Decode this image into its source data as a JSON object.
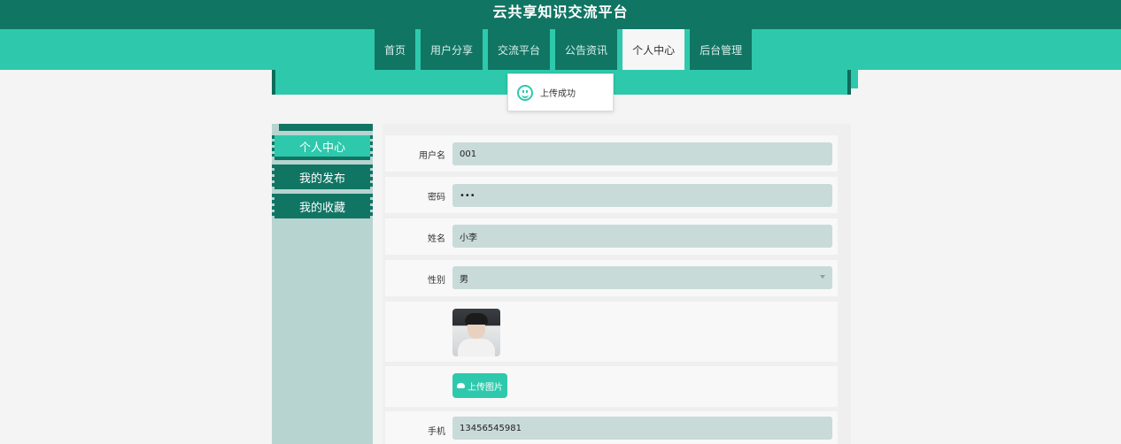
{
  "app": {
    "title": "云共享知识交流平台"
  },
  "nav": {
    "items": [
      {
        "label": "首页"
      },
      {
        "label": "用户分享"
      },
      {
        "label": "交流平台"
      },
      {
        "label": "公告资讯"
      },
      {
        "label": "个人中心",
        "active": true
      },
      {
        "label": "后台管理"
      }
    ]
  },
  "toast": {
    "icon": "smile-icon",
    "text": "上传成功"
  },
  "sidebar": {
    "items": [
      {
        "label": "个人中心",
        "active": true
      },
      {
        "label": "我的发布"
      },
      {
        "label": "我的收藏"
      }
    ]
  },
  "form": {
    "username": {
      "label": "用户名",
      "value": "001"
    },
    "password": {
      "label": "密码",
      "value": "•••"
    },
    "name": {
      "label": "姓名",
      "value": "小李"
    },
    "gender": {
      "label": "性别",
      "value": "男"
    },
    "upload_button": "上传图片",
    "phone": {
      "label": "手机",
      "value": "13456545981"
    }
  },
  "colors": {
    "primary": "#2ec9ac",
    "dark": "#117564",
    "field": "#c9dbd8"
  }
}
